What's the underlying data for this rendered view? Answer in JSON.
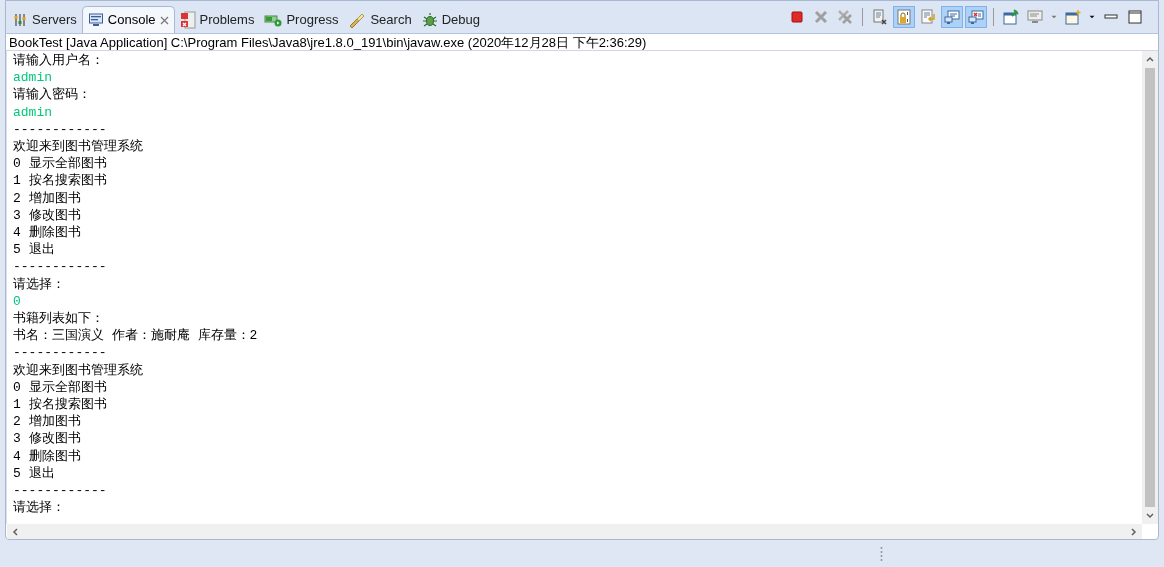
{
  "tabs": [
    {
      "label": "Servers",
      "kind": "servers",
      "selected": false
    },
    {
      "label": "Console",
      "kind": "console",
      "selected": true
    },
    {
      "label": "Problems",
      "kind": "problems",
      "selected": false
    },
    {
      "label": "Progress",
      "kind": "progress",
      "selected": false
    },
    {
      "label": "Search",
      "kind": "search",
      "selected": false
    },
    {
      "label": "Debug",
      "kind": "debug",
      "selected": false
    }
  ],
  "toolbar": [
    {
      "kind": "terminate",
      "pressed": false
    },
    {
      "kind": "remove",
      "pressed": false
    },
    {
      "kind": "remove-all",
      "pressed": false
    },
    {
      "kind": "sep"
    },
    {
      "kind": "clear",
      "pressed": false
    },
    {
      "kind": "scroll-lock",
      "pressed": true
    },
    {
      "kind": "word-wrap",
      "pressed": false
    },
    {
      "kind": "show-out",
      "pressed": true
    },
    {
      "kind": "show-err",
      "pressed": true
    },
    {
      "kind": "sep"
    },
    {
      "kind": "pin",
      "pressed": false
    },
    {
      "kind": "display",
      "pressed": false
    },
    {
      "kind": "dropdown"
    },
    {
      "kind": "open-console",
      "pressed": false
    },
    {
      "kind": "dropdown-dark"
    },
    {
      "kind": "minimize"
    },
    {
      "kind": "maximize"
    }
  ],
  "description": "BookTest [Java Application] C:\\Program Files\\Java8\\jre1.8.0_191\\bin\\javaw.exe (2020年12月28日 下午2:36:29)",
  "console": [
    {
      "text": "请输入用户名：",
      "kind": "output"
    },
    {
      "text": "admin",
      "kind": "input"
    },
    {
      "text": "请输入密码：",
      "kind": "output"
    },
    {
      "text": "admin",
      "kind": "input"
    },
    {
      "text": "------------",
      "kind": "output"
    },
    {
      "text": "欢迎来到图书管理系统",
      "kind": "output"
    },
    {
      "text": "0 显示全部图书",
      "kind": "output"
    },
    {
      "text": "1 按名搜索图书",
      "kind": "output"
    },
    {
      "text": "2 增加图书",
      "kind": "output"
    },
    {
      "text": "3 修改图书",
      "kind": "output"
    },
    {
      "text": "4 删除图书",
      "kind": "output"
    },
    {
      "text": "5 退出",
      "kind": "output"
    },
    {
      "text": "------------",
      "kind": "output"
    },
    {
      "text": "请选择：",
      "kind": "output"
    },
    {
      "text": "0",
      "kind": "input"
    },
    {
      "text": "书籍列表如下：",
      "kind": "output"
    },
    {
      "text": "书名：三国演义 作者：施耐庵 库存量：2",
      "kind": "output"
    },
    {
      "text": "------------",
      "kind": "output"
    },
    {
      "text": "欢迎来到图书管理系统",
      "kind": "output"
    },
    {
      "text": "0 显示全部图书",
      "kind": "output"
    },
    {
      "text": "1 按名搜索图书",
      "kind": "output"
    },
    {
      "text": "2 增加图书",
      "kind": "output"
    },
    {
      "text": "3 修改图书",
      "kind": "output"
    },
    {
      "text": "4 删除图书",
      "kind": "output"
    },
    {
      "text": "5 退出",
      "kind": "output"
    },
    {
      "text": "------------",
      "kind": "output"
    },
    {
      "text": "请选择：",
      "kind": "output"
    }
  ]
}
